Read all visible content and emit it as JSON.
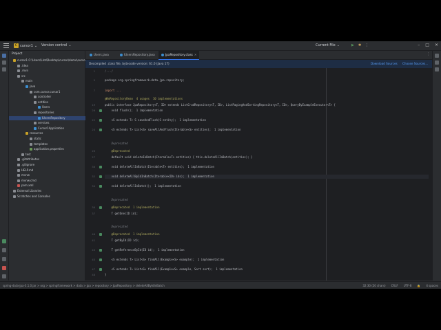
{
  "titlebar": {
    "project_badge": "C",
    "project_name": "cursor1",
    "vcs": "Version control",
    "run_config": "Current File",
    "window_buttons": [
      "–",
      "□",
      "✕"
    ]
  },
  "project_panel": {
    "title": "Project",
    "rows": [
      {
        "label": "cursor1  C:\\Users\\Lizz\\Desktop\\cursor\\demo\\cursor1",
        "indent": 1,
        "color": "#c9a227"
      },
      {
        "label": ".idea",
        "indent": 2,
        "color": "#8a8d93"
      },
      {
        "label": ".mvn",
        "indent": 2,
        "color": "#8a8d93"
      },
      {
        "label": "src",
        "indent": 2,
        "color": "#8a8d93"
      },
      {
        "label": "main",
        "indent": 3,
        "color": "#8a8d93"
      },
      {
        "label": "java",
        "indent": 4,
        "color": "#3d8fd1"
      },
      {
        "label": "com.cursor.cursor1",
        "indent": 5,
        "color": "#8a8d93"
      },
      {
        "label": "controller",
        "indent": 6,
        "color": "#8a8d93"
      },
      {
        "label": "entities",
        "indent": 6,
        "color": "#8a8d93"
      },
      {
        "label": "Users",
        "indent": 7,
        "color": "#3d8fd1"
      },
      {
        "label": "repositories",
        "indent": 6,
        "color": "#8a8d93"
      },
      {
        "label": "IUsersRepository",
        "indent": 7,
        "color": "#3d8fd1"
      },
      {
        "label": "services",
        "indent": 6,
        "color": "#8a8d93"
      },
      {
        "label": "Cursor1Application",
        "indent": 6,
        "color": "#3d8fd1"
      },
      {
        "label": "resources",
        "indent": 4,
        "color": "#c9a227"
      },
      {
        "label": "static",
        "indent": 5,
        "color": "#8a8d93"
      },
      {
        "label": "templates",
        "indent": 5,
        "color": "#8a8d93"
      },
      {
        "label": "application.properties",
        "indent": 5,
        "color": "#6a9955"
      },
      {
        "label": "test",
        "indent": 3,
        "color": "#8a8d93"
      },
      {
        "label": ".gitattributes",
        "indent": 2,
        "color": "#8a8d93"
      },
      {
        "label": ".gitignore",
        "indent": 2,
        "color": "#8a8d93"
      },
      {
        "label": "HELP.md",
        "indent": 2,
        "color": "#8a8d93"
      },
      {
        "label": "mvnw",
        "indent": 2,
        "color": "#8a8d93"
      },
      {
        "label": "mvnw.cmd",
        "indent": 2,
        "color": "#8a8d93"
      },
      {
        "label": "pom.xml",
        "indent": 2,
        "color": "#c75450"
      },
      {
        "label": "External Libraries",
        "indent": 1,
        "color": "#8a8d93"
      },
      {
        "label": "Scratches and Consoles",
        "indent": 1,
        "color": "#8a8d93"
      }
    ],
    "selected_index": 11
  },
  "tabs": [
    {
      "label": "Users.java",
      "active": false
    },
    {
      "label": "IUsersRepository.java",
      "active": false
    },
    {
      "label": "JpaRepository.class",
      "active": true
    }
  ],
  "banner": {
    "message": "Decompiled .class file, bytecode version: 61.0 (Java 17)",
    "download": "Download Sources",
    "choose": "Choose Sources..."
  },
  "editor_lines": [
    {
      "n": "1",
      "code": "/.../",
      "cls": "cm"
    },
    {
      "n": "5",
      "code": "package org.springframework.data.jpa.repository;",
      "cls": ""
    },
    {
      "n": "7",
      "code": "import ...",
      "cls": "kw"
    },
    {
      "n": "",
      "code": "@NoRepositoryBean  4 usages  10 implementations",
      "cls": "ann"
    },
    {
      "n": "19",
      "code": "public interface JpaRepository<T, ID> extends ListCrudRepository<T, ID>, ListPagingAndSortingRepository<T, ID>, QueryByExampleExecutor<T> {",
      "cls": ""
    },
    {
      "n": "20",
      "code": "    void flush();  1 implementation",
      "cls": ""
    },
    {
      "n": "22",
      "code": "    <S extends T> S saveAndFlush(S entity);  1 implementation",
      "cls": ""
    },
    {
      "n": "24",
      "code": "    <S extends T> List<S> saveAllAndFlush(Iterable<S> entities);  1 implementation",
      "cls": ""
    },
    {
      "n": "",
      "code": "    Deprecated",
      "cls": "cm"
    },
    {
      "n": "26",
      "code": "    @Deprecated",
      "cls": "ann"
    },
    {
      "n": "27",
      "code": "    default void deleteInBatch(Iterable<T> entities) { this.deleteAllInBatch(entities); }",
      "cls": ""
    },
    {
      "n": "30",
      "code": "    void deleteAllInBatch(Iterable<T> entities);  1 implementation",
      "cls": ""
    },
    {
      "n": "32",
      "code": "    void deleteAllByIdInBatch(Iterable<ID> ids);  1 implementation",
      "cls": "current"
    },
    {
      "n": "34",
      "code": "    void deleteAllInBatch();  1 implementation",
      "cls": ""
    },
    {
      "n": "",
      "code": "    Deprecated",
      "cls": "cm"
    },
    {
      "n": "36",
      "code": "    @Deprecated  1 implementation",
      "cls": "ann"
    },
    {
      "n": "37",
      "code": "    T getOne(ID id);",
      "cls": ""
    },
    {
      "n": "",
      "code": "    Deprecated",
      "cls": "cm"
    },
    {
      "n": "40",
      "code": "    @Deprecated  1 implementation",
      "cls": "ann"
    },
    {
      "n": "41",
      "code": "    T getById(ID id);",
      "cls": ""
    },
    {
      "n": "43",
      "code": "    T getReferenceById(ID id);  1 implementation",
      "cls": ""
    },
    {
      "n": "45",
      "code": "    <S extends T> List<S> findAll(Example<S> example);  1 implementation",
      "cls": ""
    },
    {
      "n": "47",
      "code": "    <S extends T> List<S> findAll(Example<S> example, Sort sort);  1 implementation",
      "cls": ""
    },
    {
      "n": "48",
      "code": "}",
      "cls": ""
    }
  ],
  "statusbar": {
    "breadcrumb": "spring-data-jpa-3.1.0.jar  >  org  >  springframework  >  data  >  jpa  >  repository  >  JpaRepository  >  deleteAllByIdInBatch",
    "position": "32:30 (20 chars)",
    "line_sep": "CRLF",
    "encoding": "UTF-8",
    "indent": "4 spaces"
  }
}
